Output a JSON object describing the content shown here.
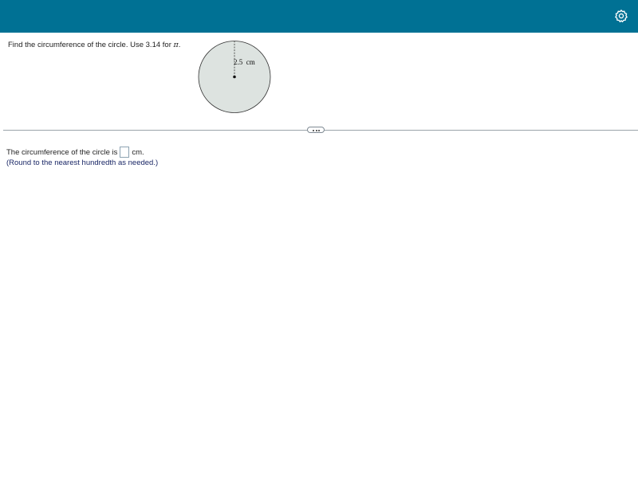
{
  "header": {
    "background_color": "#007194",
    "settings_icon": "gear-icon"
  },
  "question": {
    "text": "Find the circumference of the circle. Use 3.14 for ",
    "pi": "π",
    "end": "."
  },
  "figure": {
    "radius_label": "2.5  cm",
    "circle_fill": "#dde3e0"
  },
  "divider": {
    "handle_icon": "ellipsis-icon"
  },
  "answer": {
    "prefix": "The circumference of the circle is",
    "input_value": "",
    "suffix": "cm.",
    "hint": "(Round to the nearest hundredth as needed.)"
  }
}
